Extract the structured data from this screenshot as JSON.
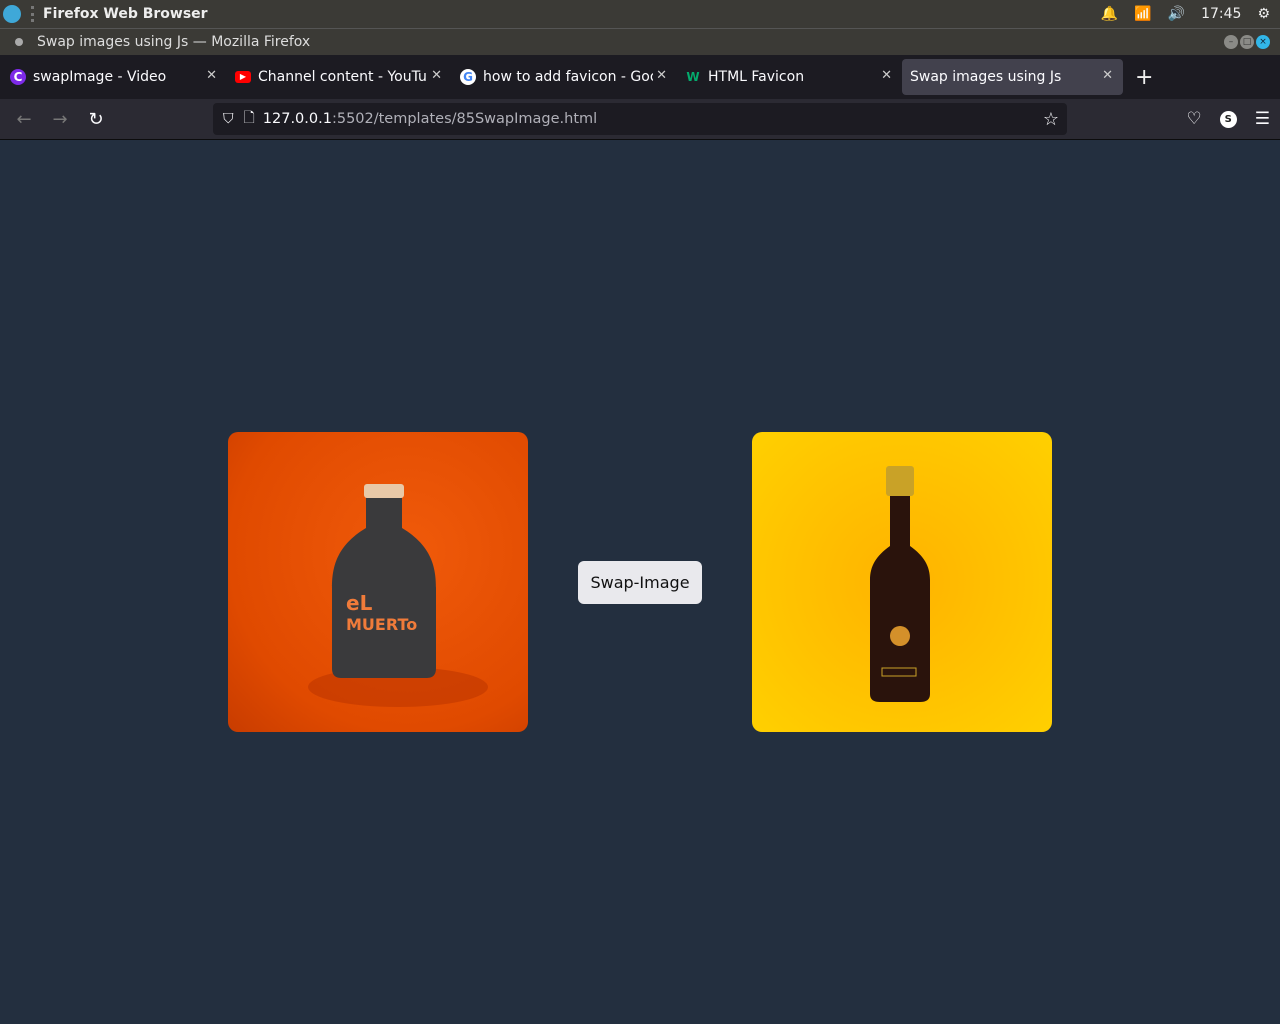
{
  "os": {
    "app_name": "Firefox Web Browser",
    "time": "17:45"
  },
  "window": {
    "title": "Swap images using Js — Mozilla Firefox"
  },
  "tabs": [
    {
      "label": "swapImage - Video",
      "favicon": "canva-icon",
      "color": "#7d2ae8"
    },
    {
      "label": "Channel content - YouTube",
      "favicon": "youtube-icon",
      "color": "#ff0000"
    },
    {
      "label": "how to add favicon - Google Search",
      "favicon": "google-icon",
      "color": "#4285f4"
    },
    {
      "label": "HTML Favicon",
      "favicon": "w3schools-icon",
      "color": "#04aa6d"
    },
    {
      "label": "Swap images using Js",
      "active": true
    }
  ],
  "url": {
    "host": "127.0.0.1",
    "path": ":5502/templates/85SwapImage.html"
  },
  "profile_initial": "S",
  "page": {
    "button_label": "Swap-Image",
    "background": "#232f3f",
    "images": [
      {
        "alt": "El Muerto bottle on orange background",
        "color": "#e84e00"
      },
      {
        "alt": "Sauce bottle on yellow background",
        "color": "#ffc200"
      }
    ]
  }
}
